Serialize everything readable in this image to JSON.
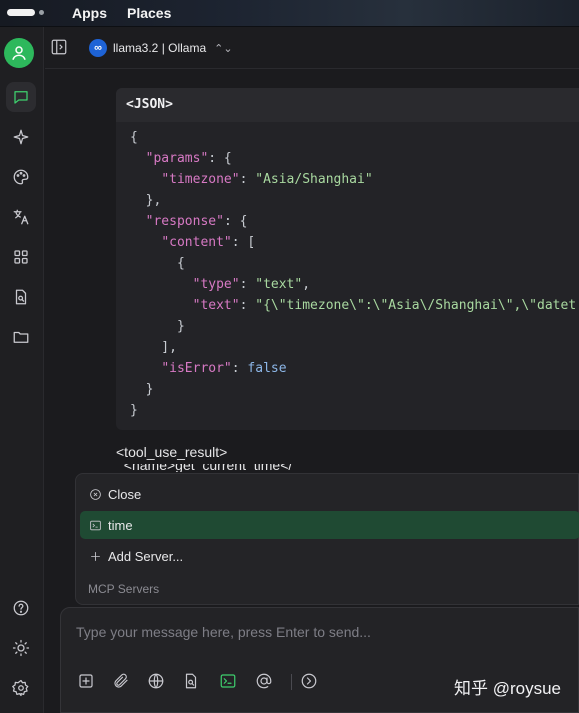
{
  "topbar": {
    "menu": [
      "Apps",
      "Places"
    ]
  },
  "header": {
    "model": "llama3.2 | Ollama",
    "model_logo": "∞"
  },
  "codeblock": {
    "title": "<JSON>",
    "lines": [
      [
        [
          "p",
          "{"
        ]
      ],
      [
        [
          "p",
          "  "
        ],
        [
          "k",
          "\"params\""
        ],
        [
          "p",
          ": {"
        ]
      ],
      [
        [
          "p",
          "    "
        ],
        [
          "k",
          "\"timezone\""
        ],
        [
          "p",
          ": "
        ],
        [
          "s",
          "\"Asia/Shanghai\""
        ]
      ],
      [
        [
          "p",
          "  },"
        ]
      ],
      [
        [
          "p",
          "  "
        ],
        [
          "k",
          "\"response\""
        ],
        [
          "p",
          ": {"
        ]
      ],
      [
        [
          "p",
          "    "
        ],
        [
          "k",
          "\"content\""
        ],
        [
          "p",
          ": ["
        ]
      ],
      [
        [
          "p",
          "      {"
        ]
      ],
      [
        [
          "p",
          "        "
        ],
        [
          "k",
          "\"type\""
        ],
        [
          "p",
          ": "
        ],
        [
          "s",
          "\"text\""
        ],
        [
          "p",
          ","
        ]
      ],
      [
        [
          "p",
          "        "
        ],
        [
          "k",
          "\"text\""
        ],
        [
          "p",
          ": "
        ],
        [
          "s",
          "\"{\\\"timezone\\\":\\\"Asia\\/Shanghai\\\",\\\"datet"
        ]
      ],
      [
        [
          "p",
          "      }"
        ]
      ],
      [
        [
          "p",
          "    ],"
        ]
      ],
      [
        [
          "p",
          "    "
        ],
        [
          "k",
          "\"isError\""
        ],
        [
          "p",
          ": "
        ],
        [
          "b",
          "false"
        ]
      ],
      [
        [
          "p",
          "  }"
        ]
      ],
      [
        [
          "p",
          "}"
        ]
      ]
    ]
  },
  "tool_result_tag": "<tool_use_result>",
  "tool_result_partial": "  <name>get_current_time</",
  "mcp_menu": {
    "close_label": "Close",
    "server_label": "time",
    "add_label": "Add Server...",
    "section_label": "MCP Servers"
  },
  "composer": {
    "placeholder": "Type your message here, press Enter to send..."
  },
  "watermark": "知乎 @roysue",
  "colors": {
    "accent": "#3ecf6e",
    "selected_bg": "#1f4a33",
    "brand_blue": "#1e63d6"
  }
}
